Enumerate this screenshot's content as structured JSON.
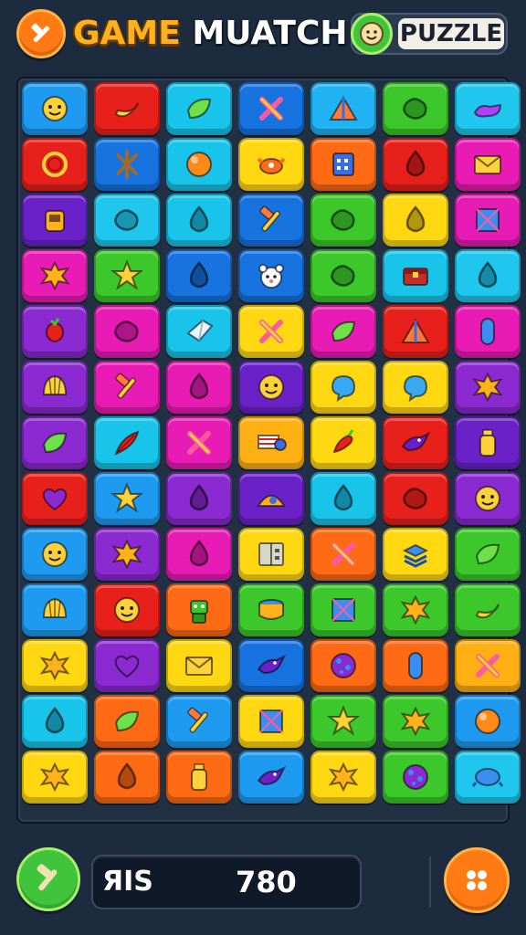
{
  "header": {
    "title_part1": "GAME",
    "title_part2": "MUATCH",
    "badge_label": "PUZZLE",
    "menu_icon": "hammer-icon",
    "badge_icon": "smiley-icon"
  },
  "board": {
    "rows": [
      [
        {
          "color": "#1e9bf0",
          "icon": "face"
        },
        {
          "color": "#e8201c",
          "icon": "banana"
        },
        {
          "color": "#19c4ea",
          "icon": "leaf"
        },
        {
          "color": "#1673e0",
          "icon": "cross"
        },
        {
          "color": "#20b2f2",
          "icon": "tent"
        },
        {
          "color": "#3cc82a",
          "icon": "blob"
        },
        {
          "color": "#1fc6ee",
          "icon": "slipper"
        }
      ],
      [
        {
          "color": "#e8201c",
          "icon": "ring"
        },
        {
          "color": "#1673e0",
          "icon": "sticks"
        },
        {
          "color": "#19c4ea",
          "icon": "orb"
        },
        {
          "color": "#ffd812",
          "icon": "crab"
        },
        {
          "color": "#ff6a14",
          "icon": "panel"
        },
        {
          "color": "#e8201c",
          "icon": "drop"
        },
        {
          "color": "#e81cb4",
          "icon": "envelope"
        }
      ],
      [
        {
          "color": "#6a22c8",
          "icon": "cup"
        },
        {
          "color": "#1fc6ee",
          "icon": "blob"
        },
        {
          "color": "#19c4ea",
          "icon": "drop"
        },
        {
          "color": "#1673e0",
          "icon": "hammer"
        },
        {
          "color": "#3cc82a",
          "icon": "blob"
        },
        {
          "color": "#ffd812",
          "icon": "drop"
        },
        {
          "color": "#e81cb4",
          "icon": "box"
        }
      ],
      [
        {
          "color": "#e81cb4",
          "icon": "splat"
        },
        {
          "color": "#3cc82a",
          "icon": "star"
        },
        {
          "color": "#1673e0",
          "icon": "drop"
        },
        {
          "color": "#1673e0",
          "icon": "bear"
        },
        {
          "color": "#3cc82a",
          "icon": "blob"
        },
        {
          "color": "#19c4ea",
          "icon": "chest"
        },
        {
          "color": "#1fc6ee",
          "icon": "drop"
        }
      ],
      [
        {
          "color": "#8a2ad0",
          "icon": "berry"
        },
        {
          "color": "#e81cb4",
          "icon": "blob"
        },
        {
          "color": "#19c4ea",
          "icon": "gem"
        },
        {
          "color": "#ffd812",
          "icon": "cross"
        },
        {
          "color": "#e81cb4",
          "icon": "leaf"
        },
        {
          "color": "#e8201c",
          "icon": "tent"
        },
        {
          "color": "#e81cb4",
          "icon": "pill"
        }
      ],
      [
        {
          "color": "#8a2ad0",
          "icon": "shell"
        },
        {
          "color": "#e81cb4",
          "icon": "hammer"
        },
        {
          "color": "#e81cb4",
          "icon": "drop"
        },
        {
          "color": "#6a22c8",
          "icon": "face"
        },
        {
          "color": "#ffd812",
          "icon": "bubble"
        },
        {
          "color": "#ffd812",
          "icon": "bubble"
        },
        {
          "color": "#8a2ad0",
          "icon": "splat"
        }
      ],
      [
        {
          "color": "#8a2ad0",
          "icon": "leaf"
        },
        {
          "color": "#19c4ea",
          "icon": "feather"
        },
        {
          "color": "#e81cb4",
          "icon": "cross"
        },
        {
          "color": "#ffb012",
          "icon": "flag"
        },
        {
          "color": "#ffd812",
          "icon": "pepper"
        },
        {
          "color": "#e8201c",
          "icon": "bird"
        },
        {
          "color": "#6a22c8",
          "icon": "bottle"
        }
      ],
      [
        {
          "color": "#e8201c",
          "icon": "heart"
        },
        {
          "color": "#1e9bf0",
          "icon": "star"
        },
        {
          "color": "#8a2ad0",
          "icon": "drop"
        },
        {
          "color": "#6a22c8",
          "icon": "hat"
        },
        {
          "color": "#19c4ea",
          "icon": "drop"
        },
        {
          "color": "#e8201c",
          "icon": "blob"
        },
        {
          "color": "#8a2ad0",
          "icon": "face"
        }
      ],
      [
        {
          "color": "#1e9bf0",
          "icon": "face"
        },
        {
          "color": "#8a2ad0",
          "icon": "splat"
        },
        {
          "color": "#e81cb4",
          "icon": "drop"
        },
        {
          "color": "#ffd812",
          "icon": "book"
        },
        {
          "color": "#ff6a14",
          "icon": "cross"
        },
        {
          "color": "#ffd812",
          "icon": "stack"
        },
        {
          "color": "#3cc82a",
          "icon": "leaf"
        }
      ],
      [
        {
          "color": "#1e9bf0",
          "icon": "shell"
        },
        {
          "color": "#e8201c",
          "icon": "face"
        },
        {
          "color": "#ff6a14",
          "icon": "robot"
        },
        {
          "color": "#3cc82a",
          "icon": "drum"
        },
        {
          "color": "#3cc82a",
          "icon": "box"
        },
        {
          "color": "#3cc82a",
          "icon": "splat"
        },
        {
          "color": "#3cc82a",
          "icon": "banana"
        }
      ],
      [
        {
          "color": "#ffd812",
          "icon": "splat"
        },
        {
          "color": "#8a2ad0",
          "icon": "heart"
        },
        {
          "color": "#ffd812",
          "icon": "envelope"
        },
        {
          "color": "#1673e0",
          "icon": "bird"
        },
        {
          "color": "#ff6a14",
          "icon": "ball"
        },
        {
          "color": "#ff6a14",
          "icon": "pill"
        },
        {
          "color": "#ffb012",
          "icon": "cross"
        }
      ],
      [
        {
          "color": "#19c4ea",
          "icon": "drop"
        },
        {
          "color": "#ff6a14",
          "icon": "leaf"
        },
        {
          "color": "#1e9bf0",
          "icon": "hammer"
        },
        {
          "color": "#ffd812",
          "icon": "box"
        },
        {
          "color": "#3cc82a",
          "icon": "star"
        },
        {
          "color": "#3cc82a",
          "icon": "splat"
        },
        {
          "color": "#1e9bf0",
          "icon": "orb"
        }
      ],
      [
        {
          "color": "#ffd812",
          "icon": "splat"
        },
        {
          "color": "#ff6a14",
          "icon": "drop"
        },
        {
          "color": "#ff6a14",
          "icon": "bottle"
        },
        {
          "color": "#1e9bf0",
          "icon": "bird"
        },
        {
          "color": "#ffd812",
          "icon": "splat"
        },
        {
          "color": "#3cc82a",
          "icon": "ball"
        },
        {
          "color": "#1fc6ee",
          "icon": "turtle"
        }
      ]
    ]
  },
  "footer": {
    "score_label": "ЯIS",
    "score_value": "780",
    "hint_icon": "hammer-icon",
    "shuffle_icon": "dots-icon"
  }
}
